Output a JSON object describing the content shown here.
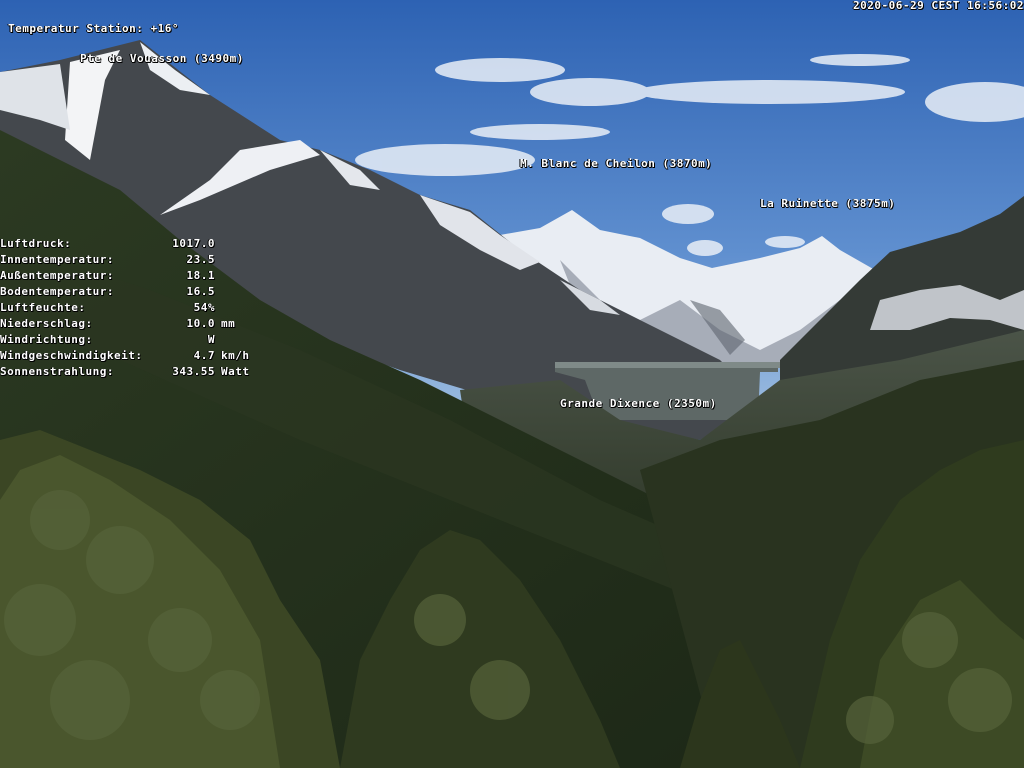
{
  "overlay": {
    "station_line1": "Temperatur Station: +16°",
    "station_line2": "Pte de Vouasson (3490m)",
    "timestamp": "2020-06-29 CEST 16:56:02"
  },
  "weather": [
    {
      "key": "Luftdruck:",
      "value": "1017.0",
      "unit": ""
    },
    {
      "key": "Innentemperatur:",
      "value": "23.5",
      "unit": ""
    },
    {
      "key": "Außentemperatur:",
      "value": "18.1",
      "unit": ""
    },
    {
      "key": "Bodentemperatur:",
      "value": "16.5",
      "unit": ""
    },
    {
      "key": "Luftfeuchte:",
      "value": "54%",
      "unit": ""
    },
    {
      "key": "Niederschlag:",
      "value": "10.0",
      "unit": "mm"
    },
    {
      "key": "Windrichtung:",
      "value": "W",
      "unit": ""
    },
    {
      "key": "Windgeschwindigkeit:",
      "value": "4.7",
      "unit": "km/h"
    },
    {
      "key": "Sonnenstrahlung:",
      "value": "343.55",
      "unit": "Watt"
    }
  ],
  "labels": {
    "blanc": "M. Blanc de Cheilon (3870m)",
    "ruinette": "La Ruinette (3875m)",
    "dixence": "Grande Dixence (2350m)"
  },
  "colors": {
    "sky_top": "#2f64b4",
    "sky_bottom": "#8fb3dc",
    "snow": "#f2f4f7",
    "rock": "#3e4248",
    "forest": "#1f2a1c",
    "tree": "#3a4424"
  }
}
